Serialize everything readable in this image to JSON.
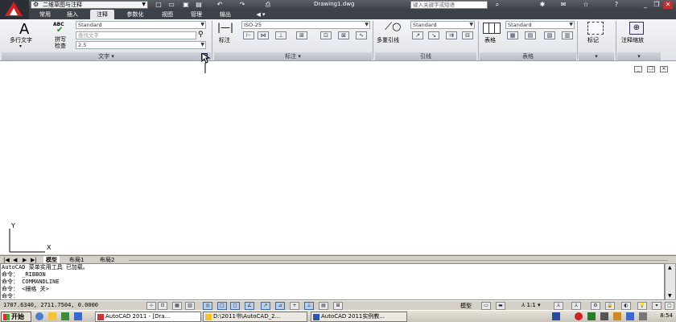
{
  "window": {
    "workspace": "二维草图与注释",
    "doc_title": "Drawing1.dwg",
    "search_placeholder": "键入关键字或短语"
  },
  "tabs": [
    "常用",
    "插入",
    "注释",
    "参数化",
    "视图",
    "管理",
    "输出"
  ],
  "active_tab": "注释",
  "ribbon": {
    "text_panel": {
      "multiline_text": "多行文字",
      "spell_check": "拼写\n检查",
      "abc": "ABC",
      "style": "Standard",
      "find_placeholder": "查找文字",
      "height": "2.5",
      "title": "文字"
    },
    "dim_panel": {
      "dimension": "标注",
      "style": "ISO-25",
      "title": "标注"
    },
    "leader_panel": {
      "multileader": "多重引线",
      "style": "Standard",
      "title": "引线"
    },
    "table_panel": {
      "table": "表格",
      "style": "Standard",
      "title": "表格"
    },
    "markup_panel": {
      "label": "标记"
    },
    "scale_panel": {
      "label": "注释缩放"
    }
  },
  "ucs": {
    "y": "Y",
    "x": "X"
  },
  "layout_tabs": [
    "模型",
    "布局1",
    "布局2"
  ],
  "command_lines": [
    "AutoCAD 菜单实用工具 已加载。",
    "命令： _RIBBON",
    "命令： COMMANDLINE",
    "命令： <栅格 关>",
    "命令："
  ],
  "status": {
    "coords": "1707.6340, 2711.7504, 0.0000",
    "model_label": "模型",
    "scale": "1:1"
  },
  "taskbar": {
    "start": "开始",
    "tasks": [
      "AutoCAD 2011 - [Dra...",
      "D:\\2011书\\AutoCAD_2...",
      "AutoCAD 2011实例教..."
    ],
    "clock": "8:54"
  }
}
